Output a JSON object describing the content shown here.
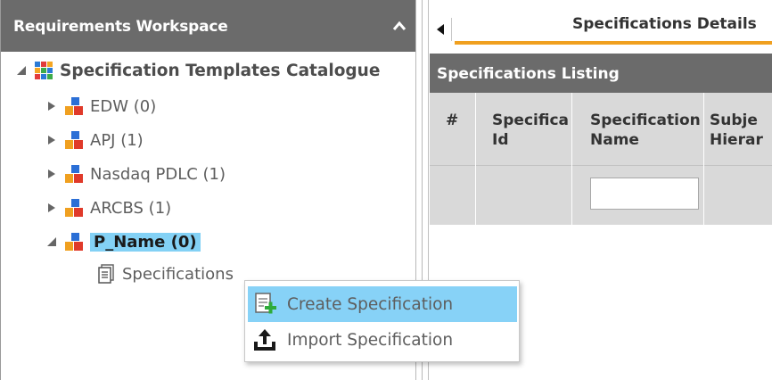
{
  "left_panel": {
    "title": "Requirements Workspace",
    "tree": {
      "root_label": "Specification Templates Catalogue",
      "items": [
        {
          "label": "EDW (0)"
        },
        {
          "label": "APJ (1)"
        },
        {
          "label": "Nasdaq PDLC (1)"
        },
        {
          "label": "ARCBS (1)"
        },
        {
          "label": "P_Name (0)",
          "selected": true
        }
      ],
      "child_label": "Specifications"
    }
  },
  "right_panel": {
    "tab_title": "Specifications Details",
    "listing_title": "Specifications Listing",
    "columns": [
      {
        "label": "#"
      },
      {
        "label": "Specifica\nId"
      },
      {
        "label": "Specification\nName"
      },
      {
        "label": "Subje\nHierar"
      }
    ],
    "name_filter_value": ""
  },
  "context_menu": {
    "items": [
      {
        "label": "Create Specification",
        "icon": "create-spec-icon",
        "highlighted": true
      },
      {
        "label": "Import Specification",
        "icon": "import-icon"
      }
    ]
  },
  "colors": {
    "header_bg": "#6b6b6b",
    "selection_bg": "#83d1f5",
    "menu_hover_bg": "#87d2f7",
    "tab_accent": "#f0a020",
    "grid_bg": "#d9d9d9"
  }
}
